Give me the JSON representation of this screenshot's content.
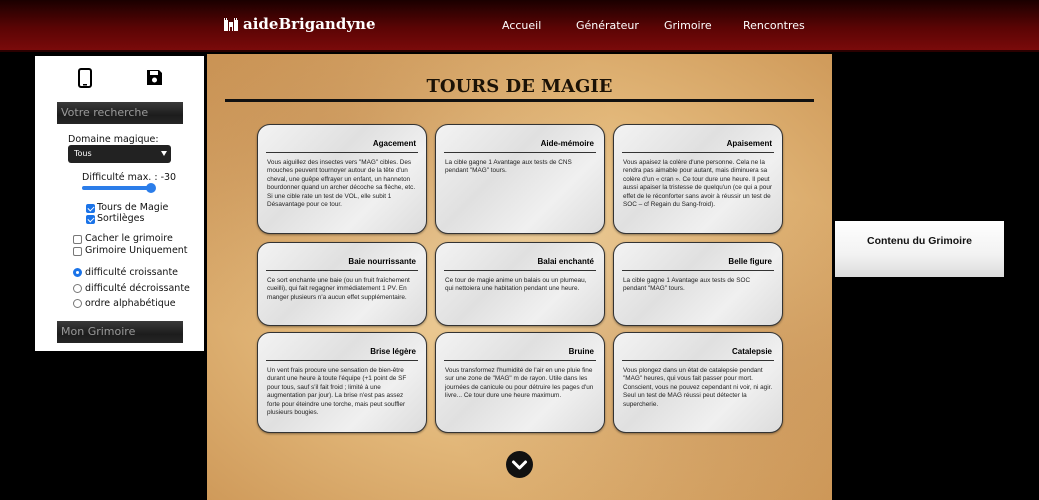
{
  "header": {
    "brand": "aideBrigandyne",
    "nav": [
      "Accueil",
      "Générateur",
      "Grimoire",
      "Rencontres"
    ]
  },
  "sidebar": {
    "icons": [
      "smartphone-icon",
      "floppy-disk-icon"
    ],
    "search_header": "Votre recherche",
    "domain_label": "Domaine magique:",
    "domain_value": "Tous",
    "difficulty_label": "Difficulté max. : -30",
    "difficulty_value": -30,
    "filters": [
      {
        "label": "Tours de Magie",
        "checked": true
      },
      {
        "label": "Sortilèges",
        "checked": true
      }
    ],
    "options": [
      {
        "label": "Cacher le grimoire",
        "checked": false
      },
      {
        "label": "Grimoire Uniquement",
        "checked": false
      }
    ],
    "sort": [
      {
        "label": "difficulté croissante",
        "selected": true
      },
      {
        "label": "difficulté décroissante",
        "selected": false
      },
      {
        "label": "ordre alphabétique",
        "selected": false
      }
    ],
    "grimoire_header": "Mon Grimoire"
  },
  "main": {
    "title": "TOURS DE MAGIE",
    "cards": [
      {
        "title": "Agacement",
        "text": "Vous aiguillez des insectes vers \"MAG\" cibles. Des mouches peuvent tournoyer autour de la tête d'un cheval, une guêpe effrayer un enfant, un hanneton bourdonner quand un archer décoche sa flèche, etc. Si une cible rate un test de VOL, elle subit 1 Désavantage pour ce tour."
      },
      {
        "title": "Aide-mémoire",
        "text": "La cible gagne 1 Avantage aux tests de CNS pendant \"MAG\" tours."
      },
      {
        "title": "Apaisement",
        "text": "Vous apaisez la colère d'une personne. Cela ne la rendra pas aimable pour autant, mais diminuera sa colère d'un « cran ». Ce tour dure une heure. Il peut aussi apaiser la tristesse de quelqu'un (ce qui a pour effet de le réconforter sans avoir à réussir un test de SOC – cf Regain du Sang-froid)."
      },
      {
        "title": "Baie nourrissante",
        "text": "Ce sort enchante une baie (ou un fruit fraîchement cueilli), qui fait regagner immédiatement 1 PV. En manger plusieurs n'a aucun effet supplémentaire."
      },
      {
        "title": "Balai enchanté",
        "text": "Ce tour de magie anime un balais ou un plumeau, qui nettoiera une habitation pendant une heure."
      },
      {
        "title": "Belle figure",
        "text": "La cible gagne 1 Avantage aux tests de SOC pendant \"MAG\" tours."
      },
      {
        "title": "Brise légère",
        "text": "Un vent frais procure une sensation de bien-être durant une heure à toute l'équipe (+1 point de SF pour tous, sauf s'il fait froid ; limité à une augmentation par jour). La brise n'est pas assez forte pour éteindre une torche, mais peut souffler plusieurs bougies."
      },
      {
        "title": "Bruine",
        "text": "Vous transformez l'humidité de l'air en une pluie fine sur une zone de \"MAG\" m de rayon. Utile dans les journées de canicule ou pour détruire les pages d'un livre... Ce tour dure une heure maximum."
      },
      {
        "title": "Catalepsie",
        "text": "Vous plongez dans un état de catalepsie pendant \"MAG\" heures, qui vous fait passer pour mort. Conscient, vous ne pouvez cependant ni voir, ni agir. Seul un test de MAG réussi peut détecter la supercherie."
      }
    ]
  },
  "right_panel": {
    "title": "Contenu du Grimoire"
  }
}
